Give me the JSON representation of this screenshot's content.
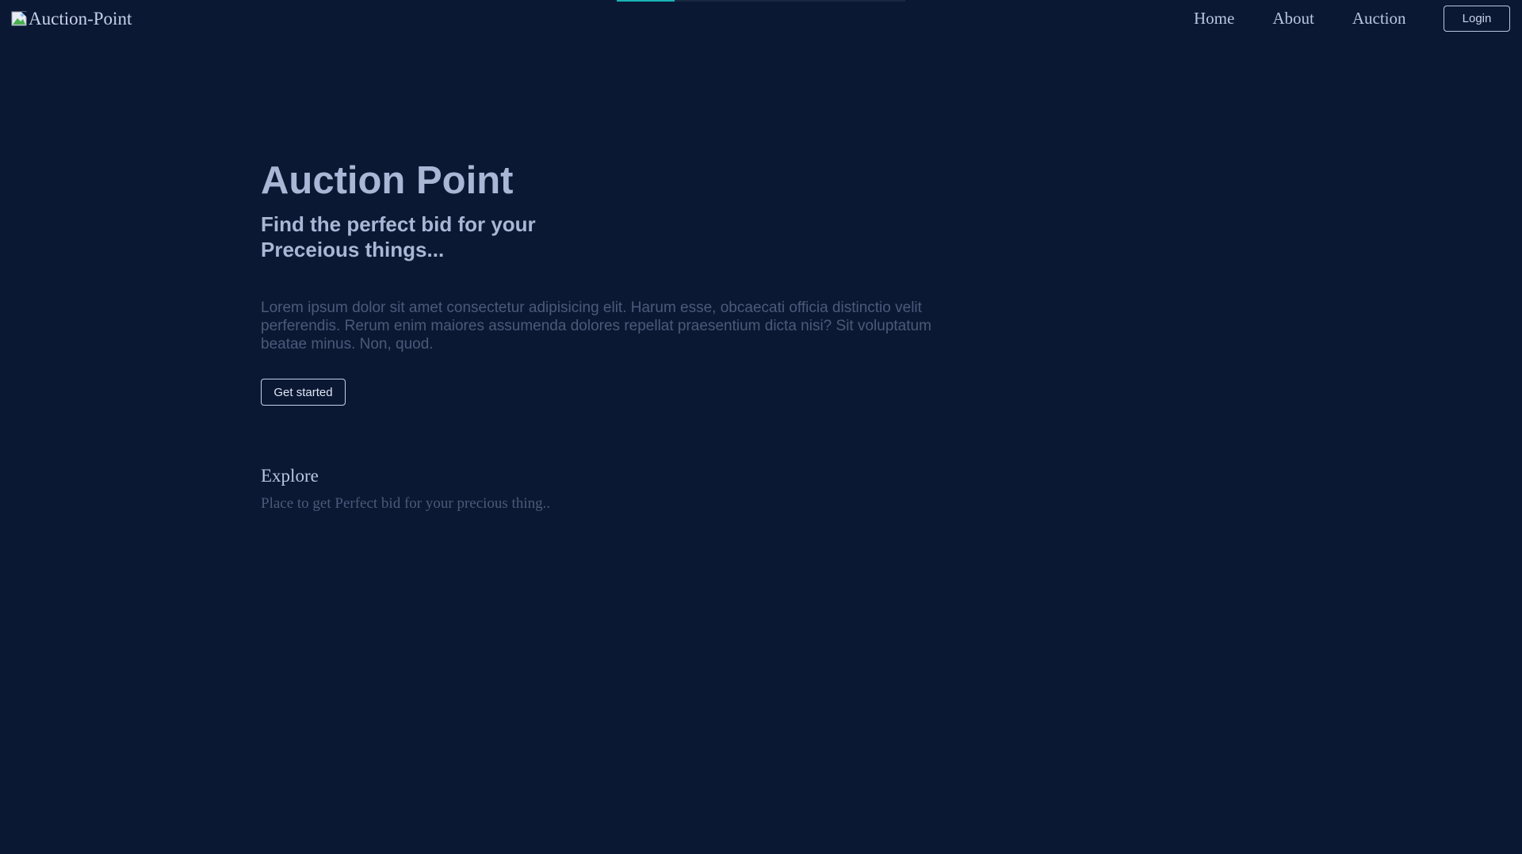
{
  "colors": {
    "background": "#0b1833",
    "heading": "#a9b7d6",
    "muted_text": "#4a5a7a",
    "nav_text": "#b9c6e2",
    "progress_accent": "#19b3b3",
    "progress_track": "#1a2740"
  },
  "top_progress": {
    "value": 0.2
  },
  "navbar": {
    "logo_alt": "Auction-Point",
    "logo_icon": "broken-image-icon",
    "links": [
      {
        "label": "Home"
      },
      {
        "label": "About"
      },
      {
        "label": "Auction"
      }
    ],
    "login_label": "Login"
  },
  "hero": {
    "title": "Auction Point",
    "subtitle": "Find the perfect bid for your Preceious things...",
    "body": "Lorem ipsum dolor sit amet consectetur adipisicing elit. Harum esse, obcaecati officia distinctio velit perferendis. Rerum enim maiores assumenda dolores repellat praesentium dicta nisi? Sit voluptatum beatae minus. Non, quod.",
    "cta_label": "Get started"
  },
  "explore": {
    "title": "Explore",
    "text": "Place to get Perfect bid for your precious thing.."
  }
}
